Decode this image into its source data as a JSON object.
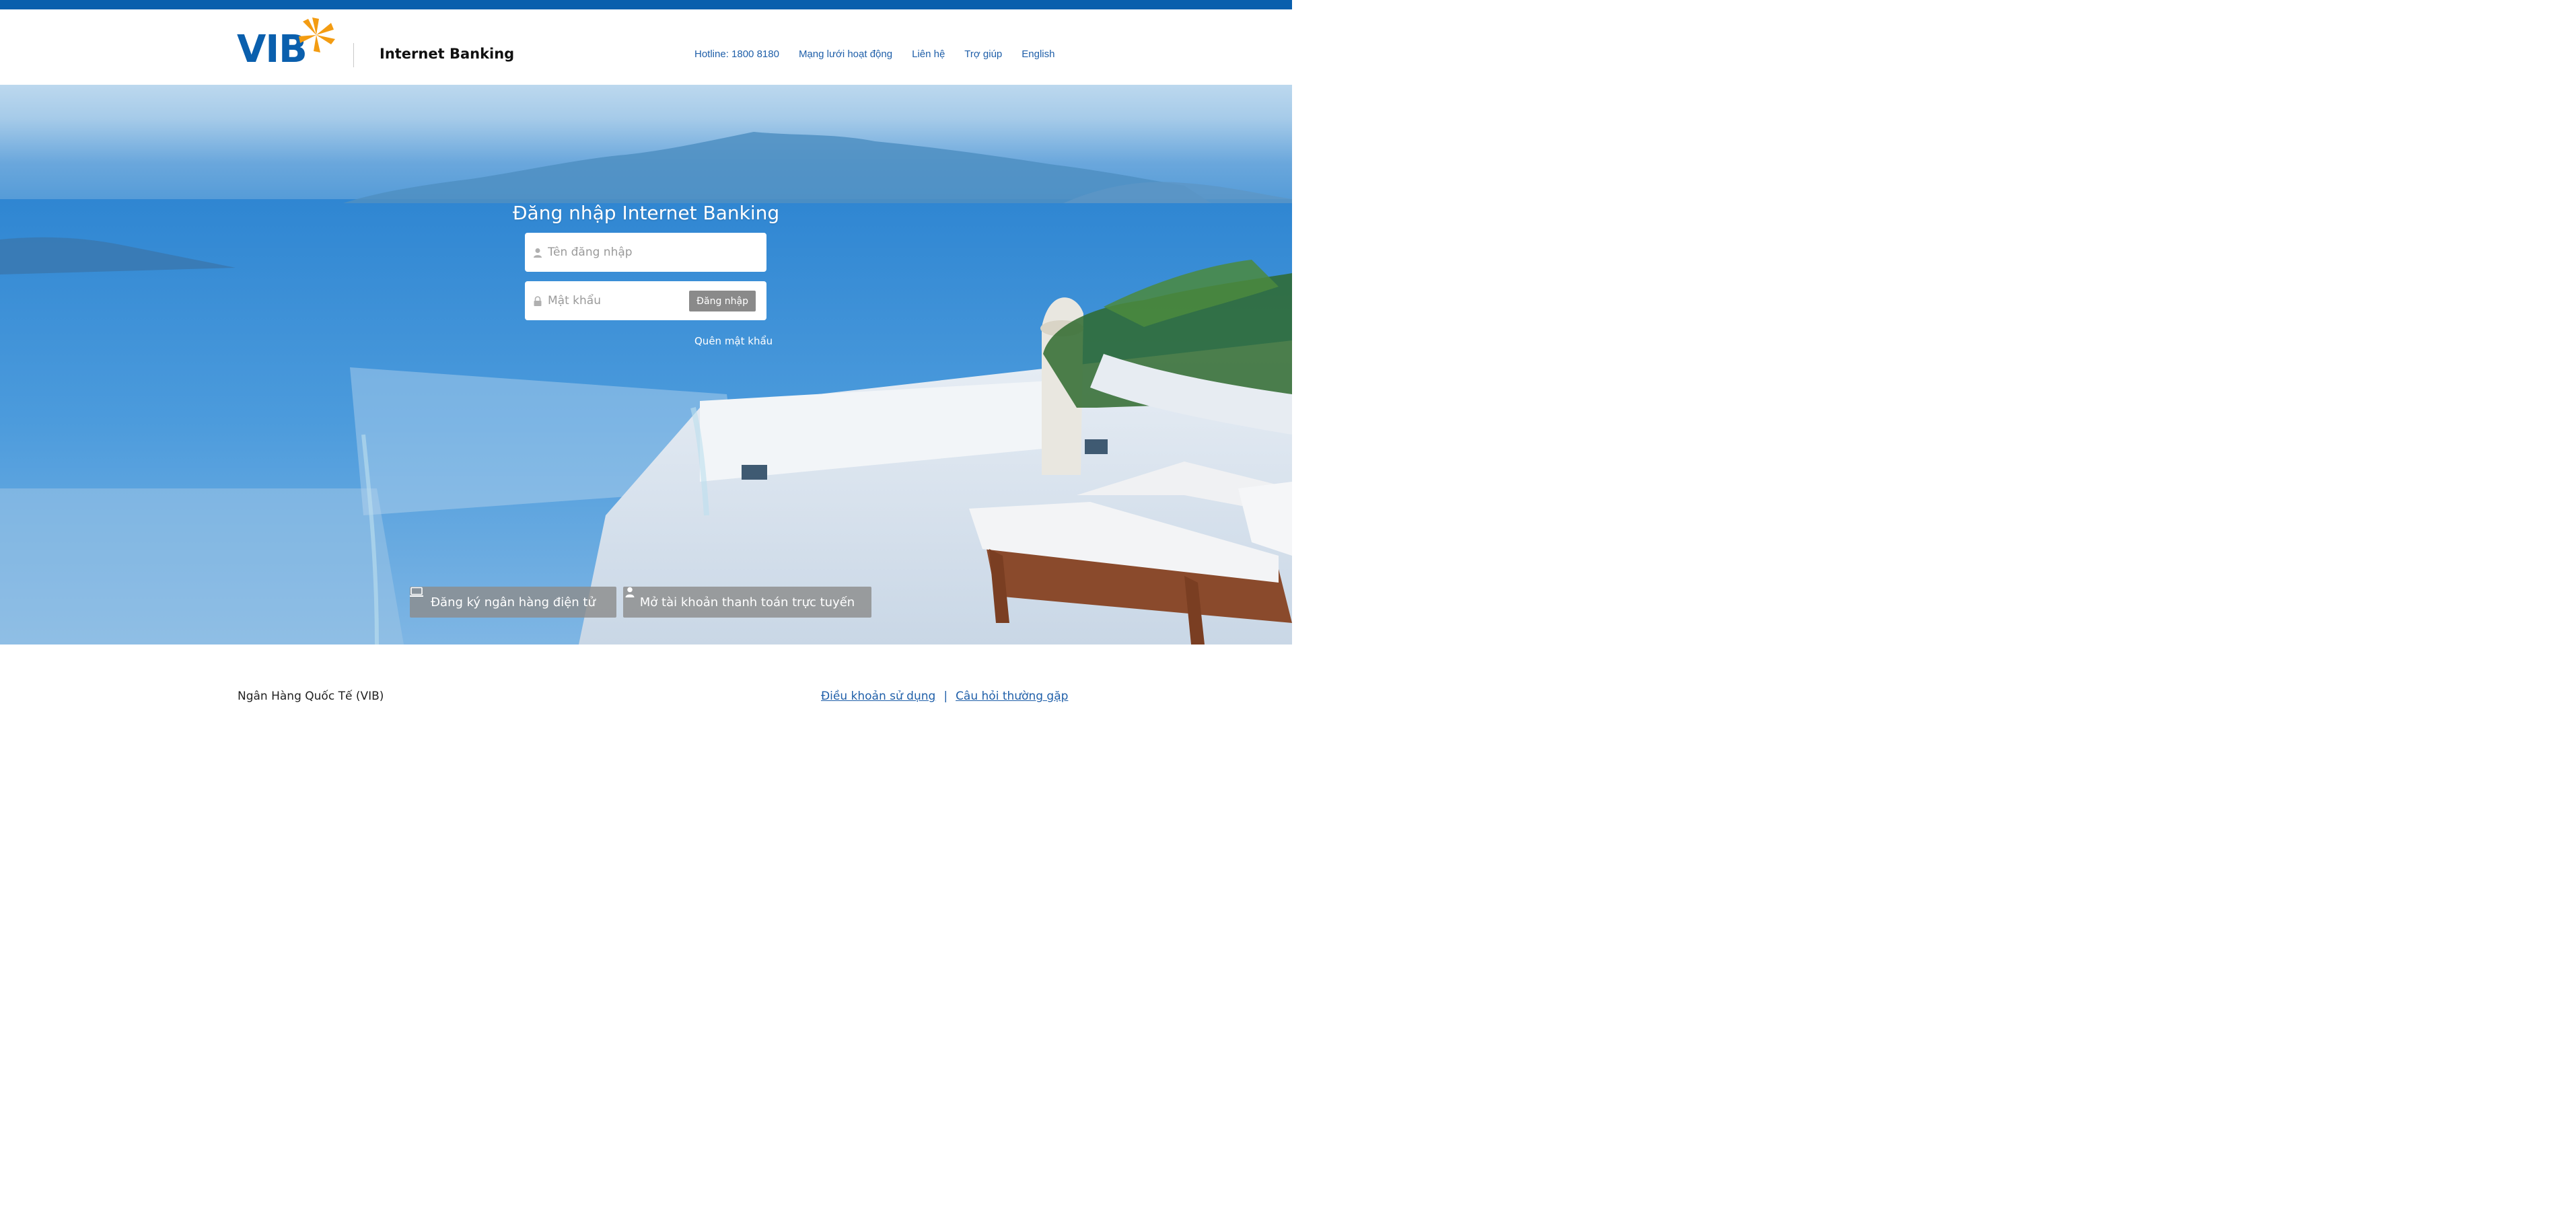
{
  "header": {
    "logo_text": "VIB",
    "app_title": "Internet Banking",
    "nav": [
      {
        "label": "Hotline: 1800 8180"
      },
      {
        "label": "Mạng lưới hoạt động"
      },
      {
        "label": "Liên hệ"
      },
      {
        "label": "Trợ giúp"
      },
      {
        "label": "English"
      }
    ]
  },
  "login": {
    "title": "Đăng nhập Internet Banking",
    "username_placeholder": "Tên đăng nhập",
    "password_placeholder": "Mật khẩu",
    "submit_label": "Đăng nhập",
    "forgot_label": "Quên mật khẩu"
  },
  "hero_buttons": {
    "register_label": "Đăng ký ngân hàng điện tử",
    "open_account_label": "Mở tài khoản thanh toán trực tuyến"
  },
  "footer": {
    "bank_name": "Ngân Hàng Quốc Tế (VIB)",
    "terms_label": "Điều khoản sử dụng",
    "separator": "|",
    "faq_label": "Câu hỏi thường gặp"
  },
  "colors": {
    "brand_blue": "#0a5fad",
    "brand_orange": "#f39c12",
    "link_blue": "#1f5fa9"
  },
  "icons": {
    "user_field": "user-icon",
    "password_field": "lock-icon",
    "register_button": "monitor-icon",
    "open_account_button": "person-icon"
  }
}
